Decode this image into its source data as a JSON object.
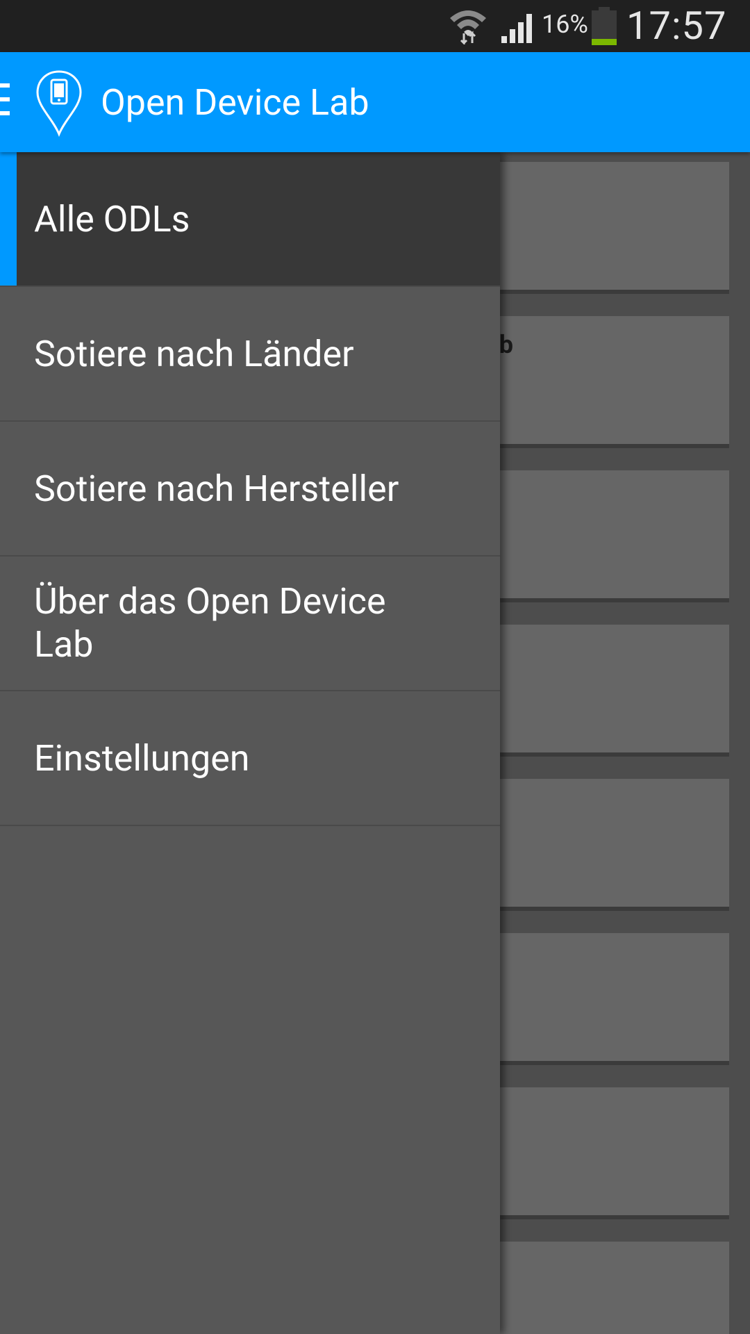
{
  "status_bar": {
    "battery_percent": "16%",
    "time": "17:57",
    "icons": [
      "wifi-icon",
      "signal-icon",
      "battery-icon"
    ],
    "battery_color": "#7cb800"
  },
  "app_bar": {
    "title": "Open Device Lab",
    "color": "#0099ff",
    "icons": [
      "menu-icon",
      "location-pin-phone-icon"
    ]
  },
  "drawer": {
    "items": [
      {
        "label": "Alle ODLs",
        "selected": true
      },
      {
        "label": "Sotiere nach Länder"
      },
      {
        "label": "Sotiere nach Hersteller"
      },
      {
        "label": "Über das Open Device Lab"
      },
      {
        "label": "Einstellungen"
      }
    ]
  },
  "list": {
    "visible_text": "Lab"
  }
}
